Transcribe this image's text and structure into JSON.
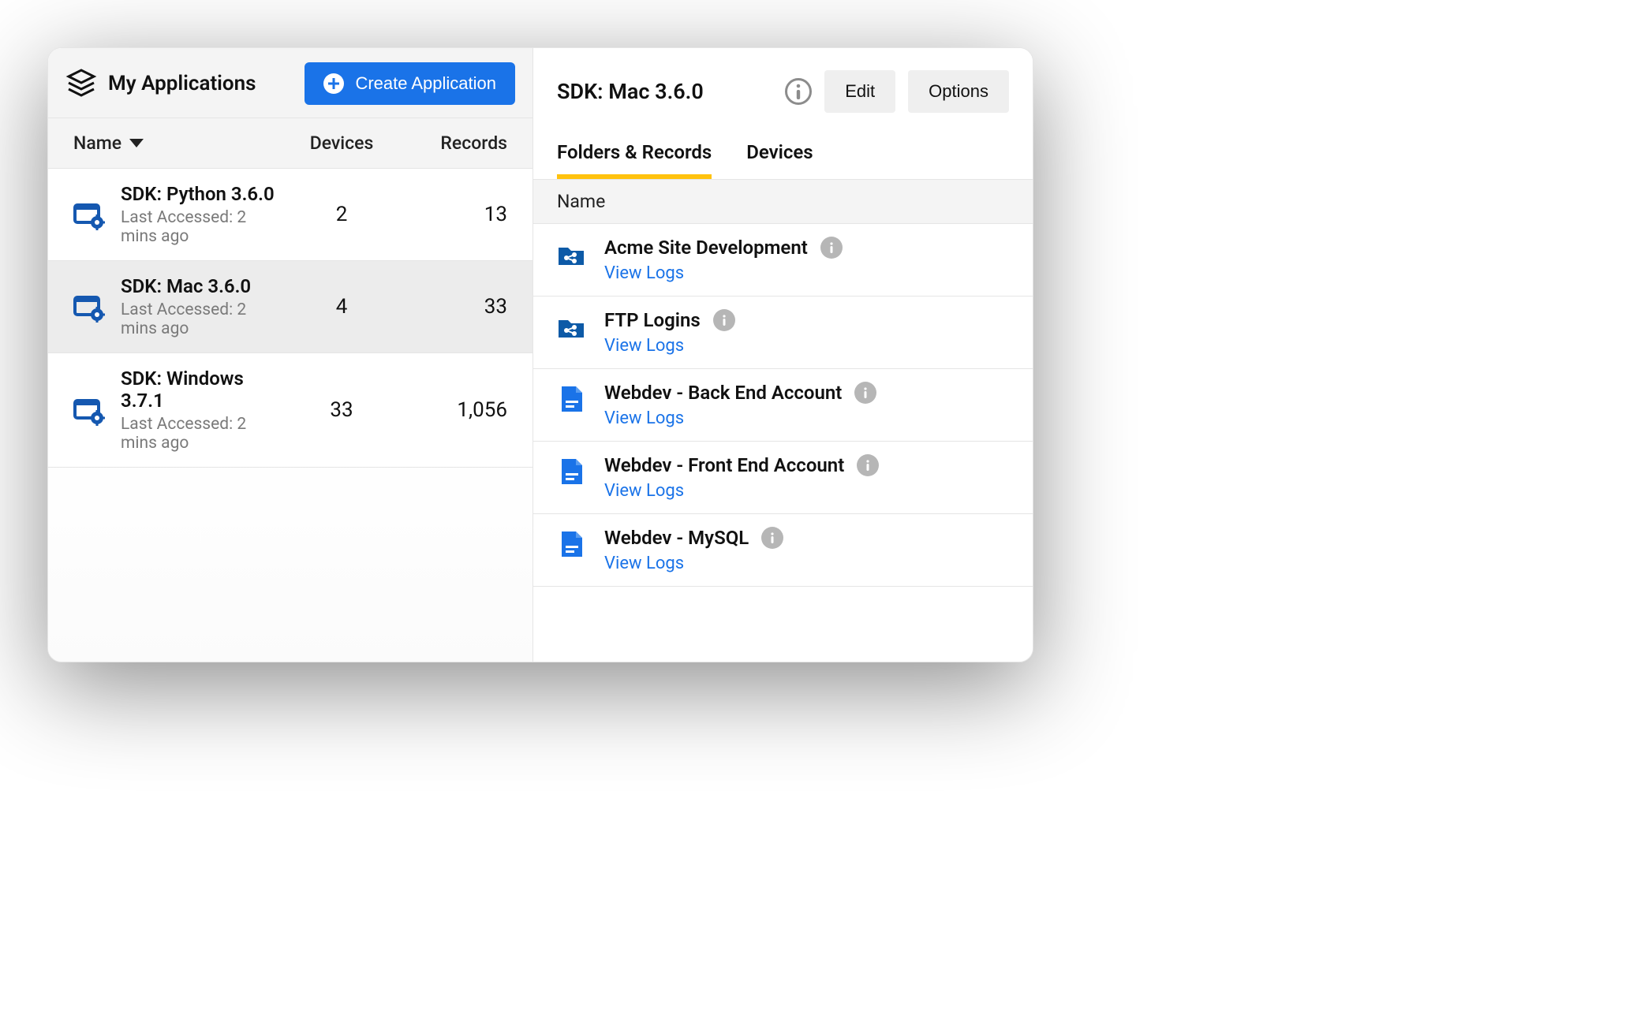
{
  "left": {
    "title": "My Applications",
    "create_button": "Create Application",
    "columns": {
      "name": "Name",
      "devices": "Devices",
      "records": "Records"
    },
    "rows": [
      {
        "name": "SDK: Python 3.6.0",
        "sub": "Last Accessed: 2 mins ago",
        "devices": "2",
        "records": "13",
        "selected": false
      },
      {
        "name": "SDK: Mac 3.6.0",
        "sub": "Last Accessed: 2 mins ago",
        "devices": "4",
        "records": "33",
        "selected": true
      },
      {
        "name": "SDK: Windows 3.7.1",
        "sub": "Last Accessed: 2 mins ago",
        "devices": "33",
        "records": "1,056",
        "selected": false
      }
    ]
  },
  "right": {
    "title": "SDK: Mac 3.6.0",
    "edit_label": "Edit",
    "options_label": "Options",
    "tabs": {
      "folders": "Folders & Records",
      "devices": "Devices"
    },
    "column": "Name",
    "view_logs_label": "View Logs",
    "items": [
      {
        "title": "Acme Site Development",
        "type": "folder"
      },
      {
        "title": "FTP Logins",
        "type": "folder"
      },
      {
        "title": "Webdev - Back End Account",
        "type": "record"
      },
      {
        "title": "Webdev - Front End Account",
        "type": "record"
      },
      {
        "title": "Webdev - MySQL",
        "type": "record"
      }
    ]
  }
}
